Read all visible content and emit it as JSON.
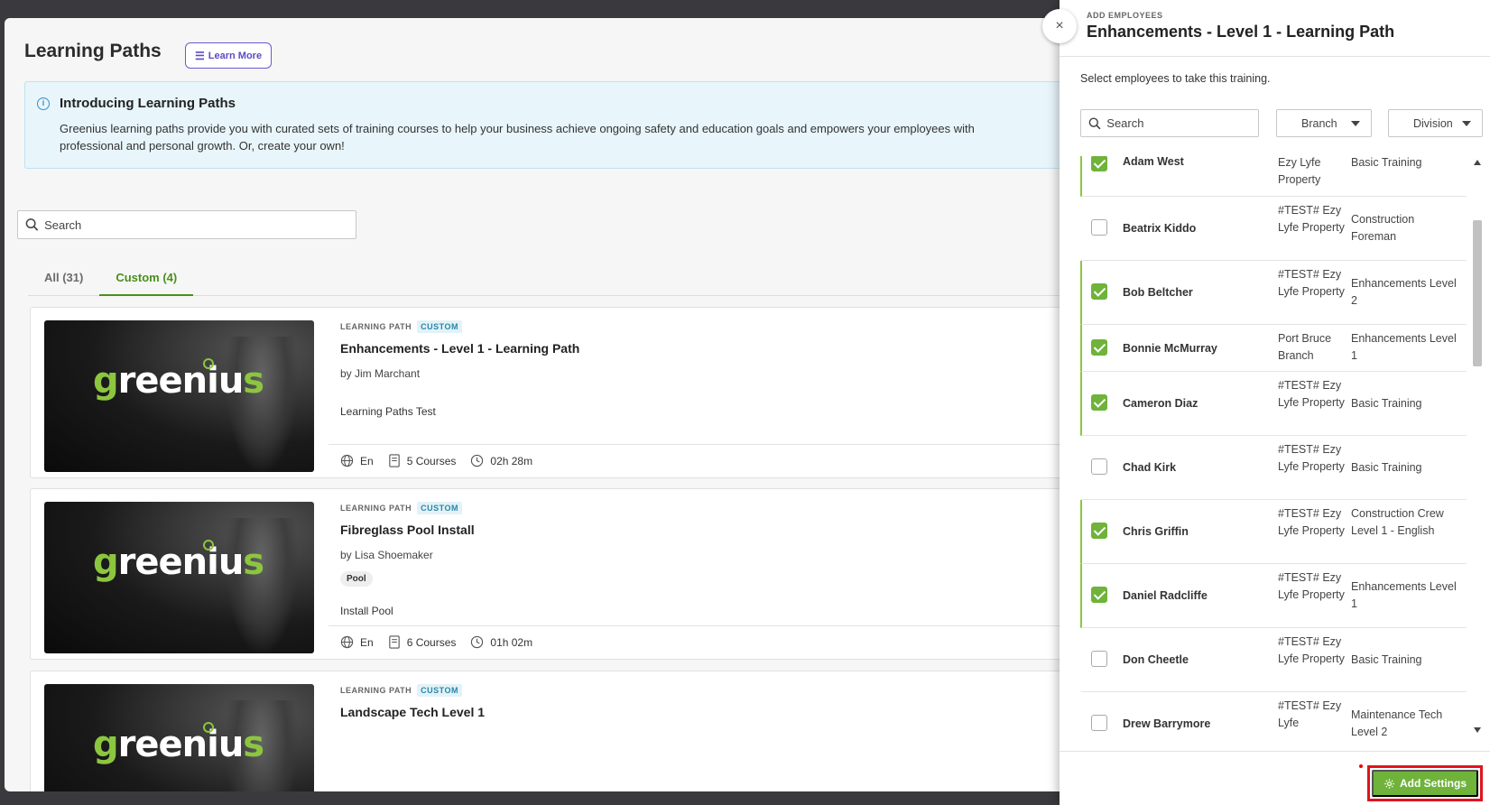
{
  "page": {
    "title": "Learning Paths",
    "learn_more": "Learn More",
    "intro": {
      "title": "Introducing Learning Paths",
      "body": "Greenius learning paths provide you with curated sets of training courses to help your business achieve ongoing safety and education goals and empowers your employees with professional and personal growth. Or, create your own!"
    },
    "search_placeholder": "Search",
    "tabs": [
      {
        "label": "All (31)",
        "active": false
      },
      {
        "label": "Custom  (4)",
        "active": true
      }
    ],
    "cards": [
      {
        "kind": "LEARNING PATH",
        "badge": "CUSTOM",
        "title": "Enhancements - Level 1 - Learning Path",
        "author": "by Jim Marchant",
        "tag": "",
        "description": "Learning Paths Test",
        "language": "En",
        "courses": "5 Courses",
        "duration": "02h 28m"
      },
      {
        "kind": "LEARNING PATH",
        "badge": "CUSTOM",
        "title": "Fibreglass Pool Install",
        "author": "by Lisa Shoemaker",
        "tag": "Pool",
        "description": "Install Pool",
        "language": "En",
        "courses": "6 Courses",
        "duration": "01h 02m"
      },
      {
        "kind": "LEARNING PATH",
        "badge": "CUSTOM",
        "title": "Landscape Tech Level 1",
        "author": "",
        "tag": "",
        "description": "",
        "language": "",
        "courses": "",
        "duration": ""
      }
    ],
    "thumbnail_logo": "greenius"
  },
  "panel": {
    "close_label": "×",
    "kicker": "ADD EMPLOYEES",
    "title": "Enhancements - Level 1 - Learning Path",
    "instruction": "Select employees to take this training.",
    "search_placeholder": "Search",
    "branch_label": "Branch",
    "division_label": "Division",
    "employees": [
      {
        "name": "Adam West",
        "branch": "Ezy Lyfe Property",
        "division": "Basic Training",
        "checked": true
      },
      {
        "name": "Beatrix Kiddo",
        "branch": "#TEST# Ezy Lyfe Property",
        "division": "Construction Foreman",
        "checked": false
      },
      {
        "name": "Bob Beltcher",
        "branch": "#TEST# Ezy Lyfe Property",
        "division": "Enhancements Level 2",
        "checked": true
      },
      {
        "name": "Bonnie McMurray",
        "branch": "Port Bruce Branch",
        "division": "Enhancements Level 1",
        "checked": true
      },
      {
        "name": "Cameron Diaz",
        "branch": "#TEST# Ezy Lyfe Property",
        "division": "Basic Training",
        "checked": true
      },
      {
        "name": "Chad Kirk",
        "branch": "#TEST# Ezy Lyfe Property",
        "division": "Basic Training",
        "checked": false
      },
      {
        "name": "Chris Griffin",
        "branch": "#TEST# Ezy Lyfe Property",
        "division": "Construction Crew Level 1 - English",
        "checked": true
      },
      {
        "name": "Daniel Radcliffe",
        "branch": "#TEST# Ezy Lyfe Property",
        "division": "Enhancements Level 1",
        "checked": true
      },
      {
        "name": "Don Cheetle",
        "branch": "#TEST# Ezy Lyfe Property",
        "division": "Basic Training",
        "checked": false
      },
      {
        "name": "Drew Barrymore",
        "branch": "#TEST# Ezy Lyfe",
        "division": "Maintenance Tech Level 2",
        "checked": false
      }
    ],
    "add_settings": "Add Settings"
  },
  "colors": {
    "accent_green": "#6fb33a",
    "tab_green": "#4a8f1c",
    "learn_more_purple": "#5b4bc4",
    "highlight_red": "#e0141e"
  }
}
